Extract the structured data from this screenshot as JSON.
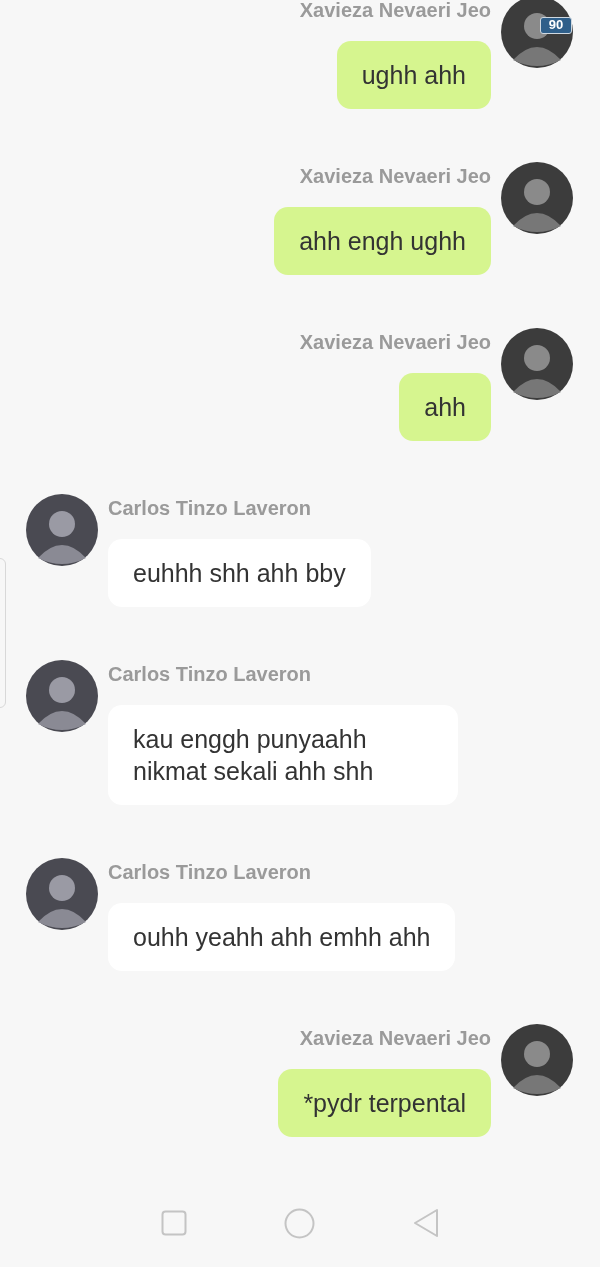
{
  "status_bar": {
    "battery": "90"
  },
  "messages": [
    {
      "kind": "sent",
      "sender": "Xavieza Nevaeri Jeo",
      "text": "ughh ahh"
    },
    {
      "kind": "sent",
      "sender": "Xavieza Nevaeri Jeo",
      "text": "ahh engh ughh"
    },
    {
      "kind": "sent",
      "sender": "Xavieza Nevaeri Jeo",
      "text": "ahh"
    },
    {
      "kind": "received",
      "sender": "Carlos Tinzo Laveron",
      "text": "euhhh shh ahh bby"
    },
    {
      "kind": "received",
      "sender": "Carlos Tinzo Laveron",
      "text": "kau enggh punyaahh nikmat sekali ahh shh"
    },
    {
      "kind": "received",
      "sender": "Carlos Tinzo Laveron",
      "text": "ouhh yeahh ahh emhh ahh"
    },
    {
      "kind": "sent",
      "sender": "Xavieza Nevaeri Jeo",
      "text": "*pydr terpental"
    }
  ]
}
